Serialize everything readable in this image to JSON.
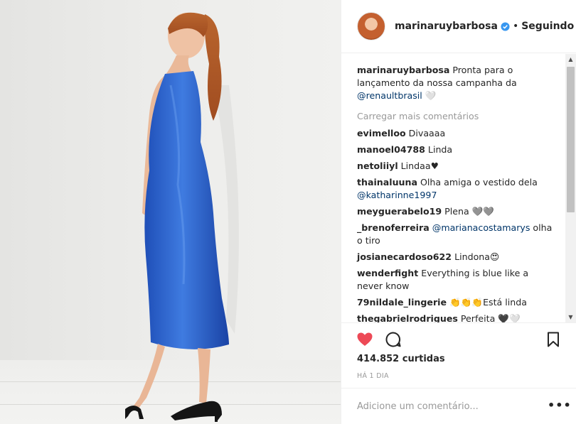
{
  "post": {
    "username": "marinaruybarbosa",
    "follow_status": "Seguindo",
    "separator": "•"
  },
  "comments": {
    "caption": {
      "user": "marinaruybarbosa",
      "text": " Pronta para o lançamento da nossa campanha da ",
      "mention": "@renaultbrasil",
      "tail": " 🤍"
    },
    "load_more": "Carregar mais comentários",
    "items": [
      {
        "user": "evimelloo",
        "text": " Divaaaa",
        "mention": "",
        "tail": ""
      },
      {
        "user": "manoel04788",
        "text": " Linda",
        "mention": "",
        "tail": ""
      },
      {
        "user": "netoliiyl",
        "text": " Lindaa♥",
        "mention": "",
        "tail": ""
      },
      {
        "user": "thainaluuna",
        "text": " Olha amiga o vestido dela ",
        "mention": "@katharinne1997",
        "tail": ""
      },
      {
        "user": "meyguerabelo19",
        "text": " Plena 🩶🩶",
        "mention": "",
        "tail": ""
      },
      {
        "user": "_brenoferreira",
        "text": " ",
        "mention": "@marianacostamarys",
        "tail": " olha o tiro"
      },
      {
        "user": "josianecardoso622",
        "text": " Lindona😍",
        "mention": "",
        "tail": ""
      },
      {
        "user": "wenderfight",
        "text": " Everything is blue like a never know",
        "mention": "",
        "tail": ""
      },
      {
        "user": "79nildale_lingerie",
        "text": " 👏👏👏Está linda",
        "mention": "",
        "tail": ""
      },
      {
        "user": "thegabrielrodrigues",
        "text": " Perfeita 🖤🤍",
        "mention": "",
        "tail": ""
      }
    ]
  },
  "icons": {
    "like": "heart-filled-icon",
    "comment": "comment-bubble-icon",
    "save": "bookmark-icon",
    "verified": "verified-badge-icon",
    "more": "more-options-icon"
  },
  "colors": {
    "like": "#ed4956",
    "mention": "#003569",
    "verified": "#3897f0",
    "muted": "#999999"
  },
  "stats": {
    "likes": "414.852 curtidas",
    "time": "HÁ 1 DIA"
  },
  "add_comment": {
    "placeholder": "Adicione um comentário...",
    "more_label": "•••"
  },
  "scrollbar": {
    "up": "▲",
    "down": "▼"
  }
}
